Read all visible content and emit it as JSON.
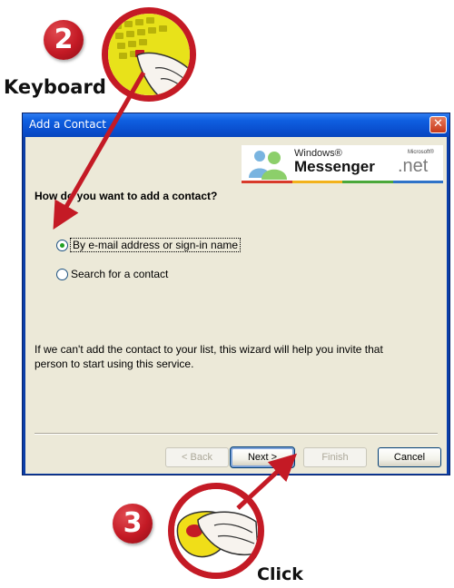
{
  "callouts": {
    "step_2": "2",
    "step_2_label": "Keyboard",
    "step_3": "3",
    "step_3_label": "Click",
    "accent_color": "#c41a25"
  },
  "window": {
    "title": "Add a Contact",
    "close_icon": "close-icon"
  },
  "brand": {
    "windows": "Windows®",
    "messenger": "Messenger",
    "microsoft": "Microsoft®",
    "net": ".net"
  },
  "dialog": {
    "question": "How do you want to add a contact?",
    "options": [
      {
        "label": "By e-mail address or sign-in name",
        "selected": true
      },
      {
        "label": "Search for a contact",
        "selected": false
      }
    ],
    "info": "If we can't add the contact to your list, this wizard will help you invite that person to start using this service."
  },
  "buttons": {
    "back": "< Back",
    "next": "Next >",
    "finish": "Finish",
    "cancel": "Cancel"
  }
}
